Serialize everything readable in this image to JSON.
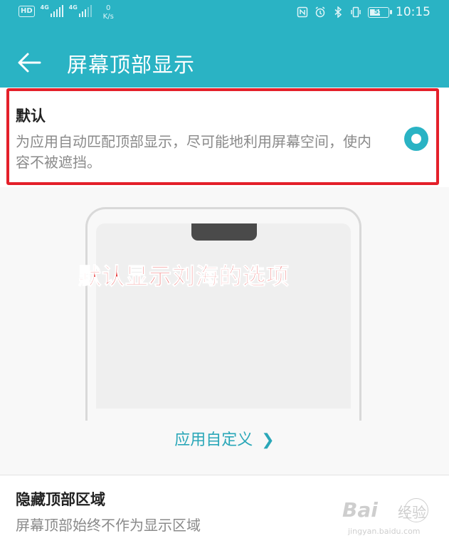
{
  "status_bar": {
    "hd_badge": "HD",
    "sim1_label": "4G",
    "sim2_label": "4G",
    "net_speed_value": "0",
    "net_speed_unit": "K/s",
    "battery_level": "55",
    "time": "10:15",
    "icons": [
      "nfc-icon",
      "alarm-icon",
      "bluetooth-icon",
      "vibrate-icon",
      "battery-icon"
    ]
  },
  "app_bar": {
    "back_icon": "arrow-left-icon",
    "title": "屏幕顶部显示"
  },
  "options": [
    {
      "title": "默认",
      "description": "为应用自动匹配顶部显示，尽可能地利用屏幕空间，使内容不被遮挡。",
      "selected": true
    },
    {
      "title": "隐藏顶部区域",
      "description": "屏幕顶部始终不作为显示区域",
      "selected": false
    }
  ],
  "annotation": {
    "text": "默认显示刘海的选项",
    "color": "#e52a2a"
  },
  "customize_link": {
    "label": "应用自定义",
    "icon": "chevron-right-icon"
  },
  "watermark": {
    "logo": "Bai",
    "text": "经验",
    "url": "jingyan.baidu.com"
  },
  "colors": {
    "accent": "#2ab3c4",
    "highlight_box": "#e4202a"
  }
}
